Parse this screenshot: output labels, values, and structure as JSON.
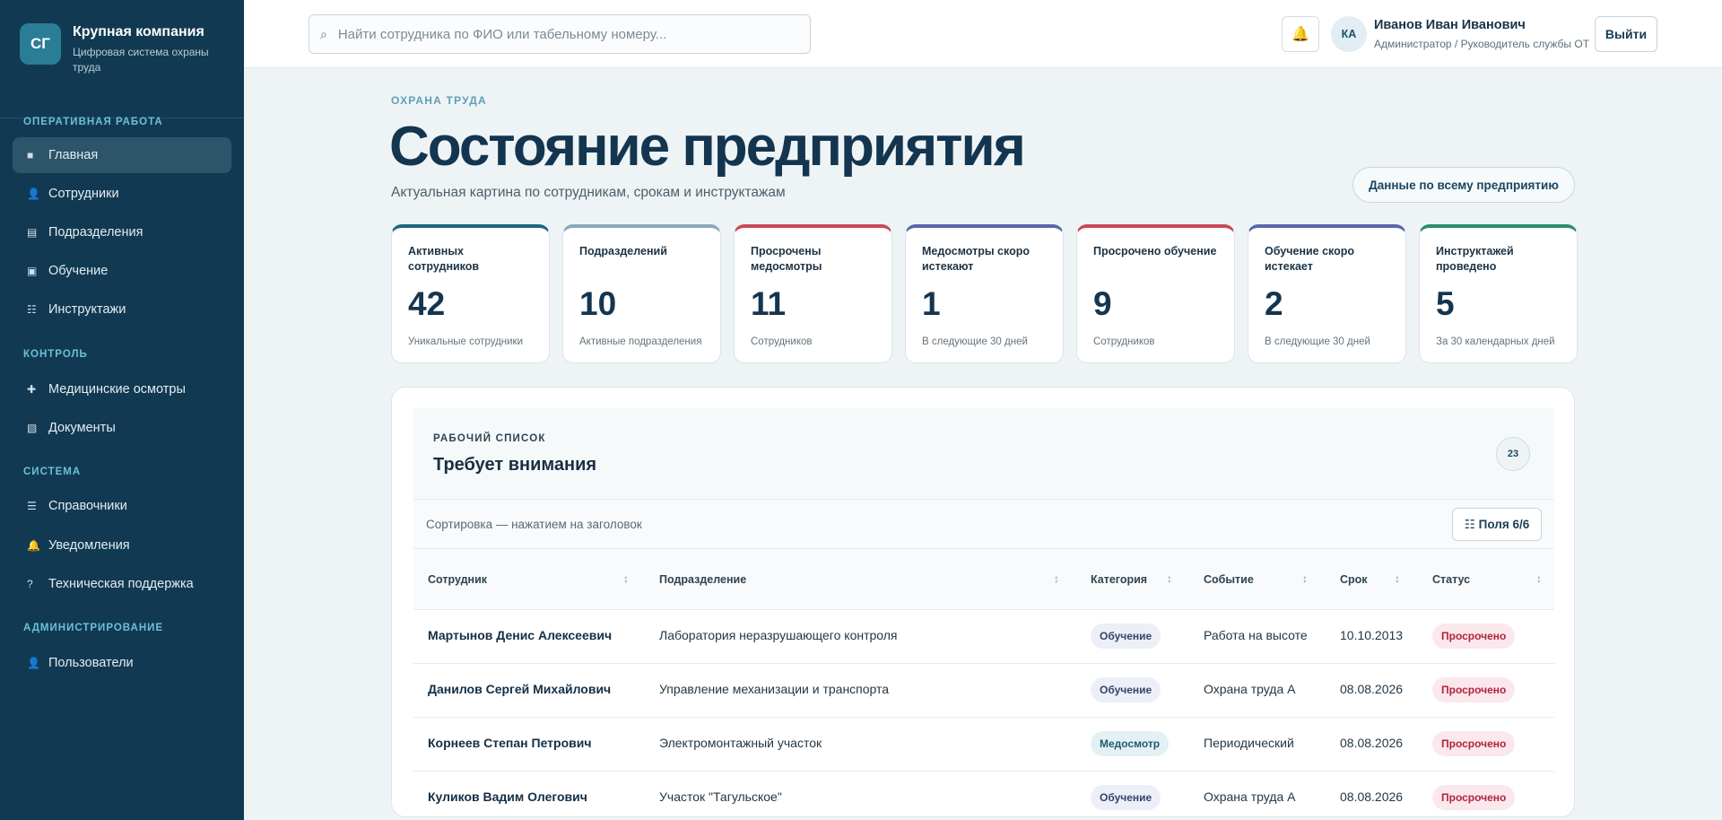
{
  "brand": {
    "logo": "СГ",
    "title": "Крупная компания",
    "subtitle": "Цифровая система охраны труда"
  },
  "nav": {
    "sections": [
      {
        "title": "Оперативная работа"
      },
      {
        "title": "Контроль"
      },
      {
        "title": "Система"
      },
      {
        "title": "Администрирование"
      }
    ],
    "items": [
      {
        "label": "Главная",
        "icon": "home-icon",
        "glyph": "■",
        "active": true
      },
      {
        "label": "Сотрудники",
        "icon": "user-icon",
        "glyph": "👤"
      },
      {
        "label": "Подразделения",
        "icon": "building-icon",
        "glyph": "▤"
      },
      {
        "label": "Обучение",
        "icon": "training-icon",
        "glyph": "▣"
      },
      {
        "label": "Инструктажи",
        "icon": "list-icon",
        "glyph": "☷"
      },
      {
        "label": "Медицинские осмотры",
        "icon": "medical-icon",
        "glyph": "✚"
      },
      {
        "label": "Документы",
        "icon": "document-icon",
        "glyph": "▧"
      },
      {
        "label": "Справочники",
        "icon": "menu-icon",
        "glyph": "☰"
      },
      {
        "label": "Уведомления",
        "icon": "bell-icon",
        "glyph": "🔔"
      },
      {
        "label": "Техническая поддержка",
        "icon": "help-icon",
        "glyph": "?"
      },
      {
        "label": "Пользователи",
        "icon": "users-icon",
        "glyph": "👤"
      }
    ]
  },
  "header": {
    "search_placeholder": "Найти сотрудника по ФИО или табельному номеру...",
    "bell_icon": "bell-icon",
    "avatar_initials": "КА",
    "user_name": "Иванов Иван Иванович",
    "user_role": "Администратор / Руководитель службы ОТ",
    "logout_label": "Выйти"
  },
  "page": {
    "eyebrow": "ОХРАНА ТРУДА",
    "title": "Состояние предприятия",
    "subtitle": "Актуальная картина по сотрудникам, срокам и инструктажам",
    "scope_button": "Данные по всему предприятию"
  },
  "stats": [
    {
      "label": "Активных сотрудников",
      "value": "42",
      "note": "Уникальные сотрудники",
      "accent": "#1f6680"
    },
    {
      "label": "Подразделений",
      "value": "10",
      "note": "Активные подразделения",
      "accent": "#8ba8ba"
    },
    {
      "label": "Просрочены медосмотры",
      "value": "11",
      "note": "Сотрудников",
      "accent": "#c94a57"
    },
    {
      "label": "Медосмотры скоро истекают",
      "value": "1",
      "note": "В следующие 30 дней",
      "accent": "#5a67aa"
    },
    {
      "label": "Просрочено обучение",
      "value": "9",
      "note": "Сотрудников",
      "accent": "#c94a57"
    },
    {
      "label": "Обучение скоро истекает",
      "value": "2",
      "note": "В следующие 30 дней",
      "accent": "#5a67aa"
    },
    {
      "label": "Инструктажей проведено",
      "value": "5",
      "note": "За 30 календарных дней",
      "accent": "#2c8c6c"
    }
  ],
  "worklist": {
    "eyebrow": "РАБОЧИЙ СПИСОК",
    "title": "Требует внимания",
    "count": "23",
    "sort_hint": "Сортировка — нажатием на заголовок",
    "fields_button": "☷ Поля 6/6",
    "columns": [
      "Сотрудник",
      "Подразделение",
      "Категория",
      "Событие",
      "Срок",
      "Статус"
    ],
    "rows": [
      {
        "employee": "Мартынов Денис Алексеевич",
        "department": "Лаборатория неразрушающего контроля",
        "category": "Обучение",
        "event": "Работа на высоте",
        "due": "10.10.2013",
        "status": "Просрочено"
      },
      {
        "employee": "Данилов Сергей Михайлович",
        "department": "Управление механизации и транспорта",
        "category": "Обучение",
        "event": "Охрана труда А",
        "due": "08.08.2026",
        "status": "Просрочено"
      },
      {
        "employee": "Корнеев Степан Петрович",
        "department": "Электромонтажный участок",
        "category": "Медосмотр",
        "event": "Периодический",
        "due": "08.08.2026",
        "status": "Просрочено"
      },
      {
        "employee": "Куликов Вадим Олегович",
        "department": "Участок \"Тагульское\"",
        "category": "Обучение",
        "event": "Охрана труда А",
        "due": "08.08.2026",
        "status": "Просрочено"
      }
    ]
  }
}
